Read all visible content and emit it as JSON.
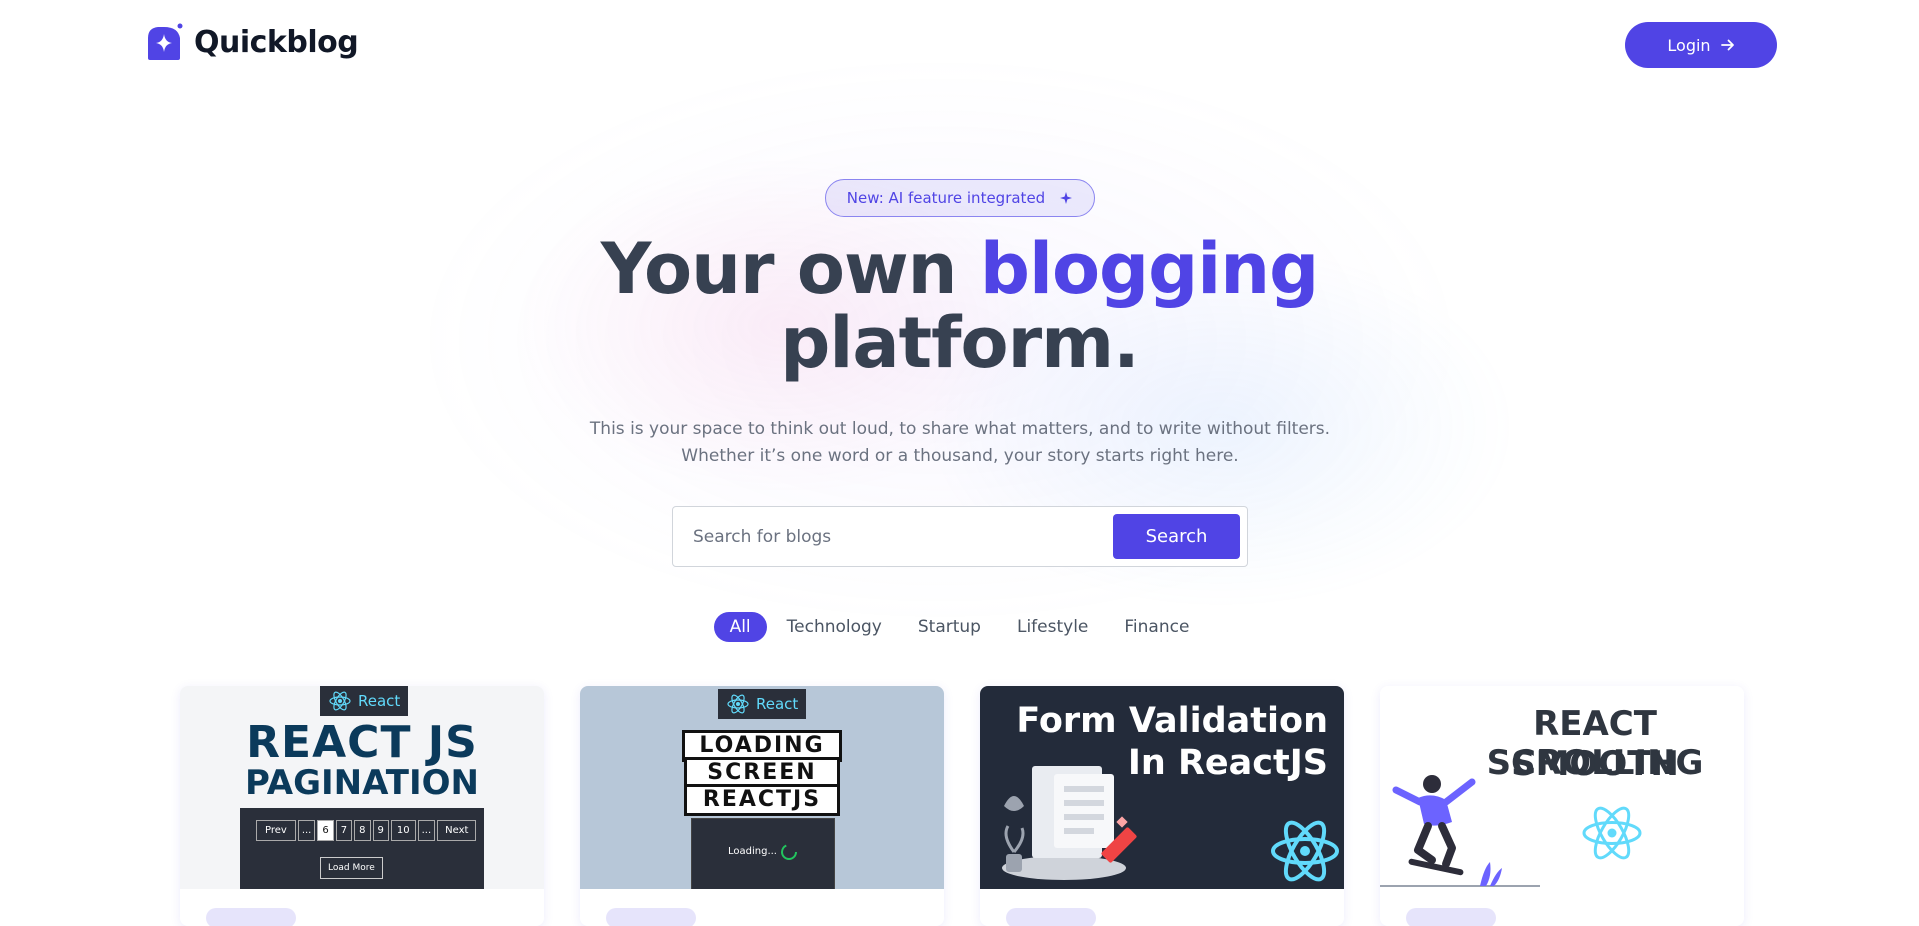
{
  "header": {
    "brand": "Quickblog",
    "login_label": "Login"
  },
  "hero": {
    "badge": "New: AI feature integrated",
    "title_part1": "Your own ",
    "title_accent": "blogging",
    "title_part2": "platform.",
    "subtitle": "This is your space to think out loud, to share what matters, and to write without filters. Whether it’s one word or a thousand, your story starts right here."
  },
  "search": {
    "placeholder": "Search for blogs",
    "button_label": "Search"
  },
  "filters": [
    "All",
    "Technology",
    "Startup",
    "Lifestyle",
    "Finance"
  ],
  "active_filter": "All",
  "cards": [
    {
      "chip": "React",
      "line1": "REACT JS",
      "line2": "PAGINATION",
      "pager": [
        "Prev",
        "...",
        "6",
        "7",
        "8",
        "9",
        "10",
        "...",
        "Next"
      ],
      "load_more": "Load More"
    },
    {
      "chip": "React",
      "lines": [
        "LOADING",
        "SCREEN",
        "REACTJS"
      ],
      "loading": "Loading..."
    },
    {
      "line1": "Form Validation",
      "line2": "In ReactJS"
    },
    {
      "line1": "REACT SMOOTH",
      "line2": "SCROLLING"
    }
  ],
  "colors": {
    "primary": "#5044e5",
    "text_dark": "#374151",
    "text_muted": "#6b7280",
    "react_cyan": "#61dafb",
    "navy_title": "#0b3a5b"
  },
  "icons": {
    "logo": "quickblog-logo-icon",
    "login": "arrow-right-icon",
    "badge": "sparkle-icon",
    "react": "react-atom-icon"
  }
}
